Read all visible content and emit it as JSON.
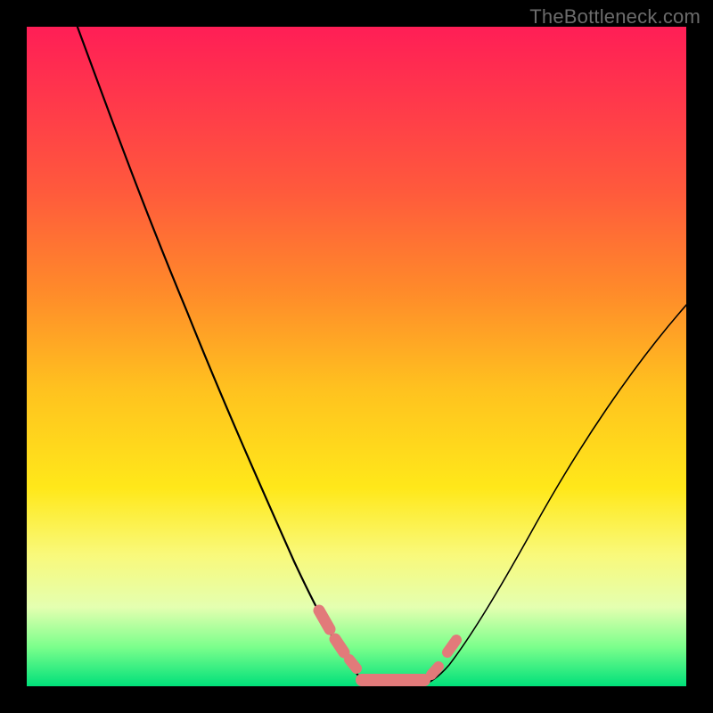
{
  "watermark": "TheBottleneck.com",
  "colors": {
    "background_frame": "#000000",
    "gradient_top": "#ff1e56",
    "gradient_mid1": "#ff8a2a",
    "gradient_mid2": "#ffe81a",
    "gradient_bottom": "#00e07a",
    "curve_stroke": "#000000",
    "bead_stroke": "#e27a7a"
  },
  "chart_data": {
    "type": "line",
    "title": "",
    "xlabel": "",
    "ylabel": "",
    "xlim": [
      0,
      100
    ],
    "ylim": [
      0,
      100
    ],
    "grid": false,
    "legend": false,
    "series": [
      {
        "name": "left_curve",
        "x": [
          5,
          10,
          15,
          20,
          25,
          30,
          35,
          40,
          44,
          47,
          50,
          53
        ],
        "y": [
          100,
          92,
          82,
          71,
          59,
          47,
          35,
          22,
          12,
          6,
          2,
          0
        ]
      },
      {
        "name": "right_curve",
        "x": [
          58,
          61,
          64,
          68,
          73,
          80,
          88,
          96,
          100
        ],
        "y": [
          0,
          2,
          6,
          13,
          22,
          34,
          46,
          56,
          60
        ]
      },
      {
        "name": "valley_floor",
        "x": [
          48,
          50,
          52,
          54,
          56,
          58,
          60
        ],
        "y": [
          1,
          0,
          0,
          0,
          0,
          0,
          1
        ]
      }
    ],
    "annotations": [
      {
        "name": "pink_beads_left",
        "approx_x_range": [
          42,
          48
        ],
        "approx_y_range": [
          3,
          12
        ],
        "description": "cluster of rounded pink segments along the lower-left of the valley"
      },
      {
        "name": "pink_beads_bottom",
        "approx_x_range": [
          48,
          60
        ],
        "approx_y_range": [
          0,
          2
        ],
        "description": "long pink segment running along the valley floor"
      },
      {
        "name": "pink_beads_right",
        "approx_x_range": [
          60,
          64
        ],
        "approx_y_range": [
          3,
          10
        ],
        "description": "short pink segments on the lower-right upswing"
      }
    ]
  }
}
